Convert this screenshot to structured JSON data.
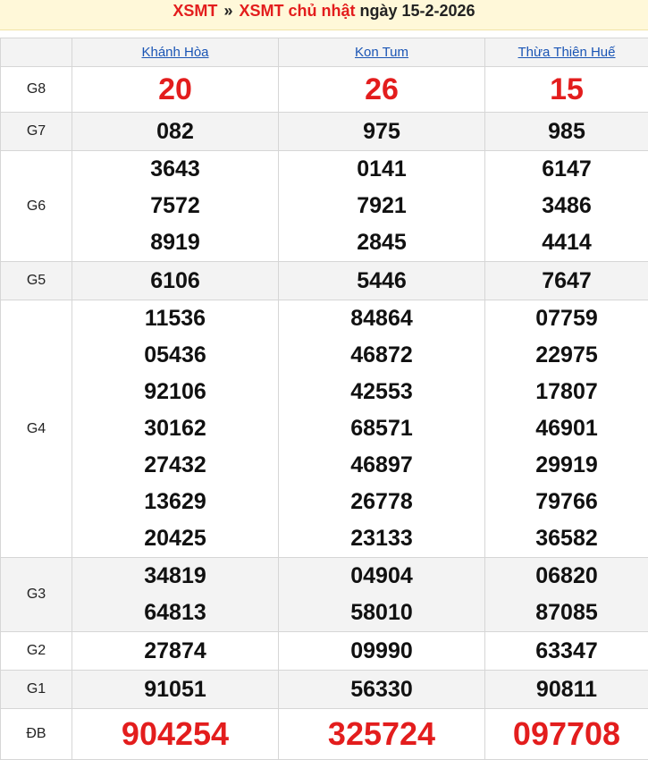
{
  "header": {
    "link1": "XSMT",
    "separator": "»",
    "link2": "XSMT chủ nhật",
    "rest": " ngày 15-2-2026"
  },
  "provinces": [
    "Khánh Hòa",
    "Kon Tum",
    "Thừa Thiên Huế"
  ],
  "prizes": [
    {
      "label": "G8",
      "cols": [
        [
          "20"
        ],
        [
          "26"
        ],
        [
          "15"
        ]
      ]
    },
    {
      "label": "G7",
      "cols": [
        [
          "082"
        ],
        [
          "975"
        ],
        [
          "985"
        ]
      ]
    },
    {
      "label": "G6",
      "cols": [
        [
          "3643",
          "7572",
          "8919"
        ],
        [
          "0141",
          "7921",
          "2845"
        ],
        [
          "6147",
          "3486",
          "4414"
        ]
      ]
    },
    {
      "label": "G5",
      "cols": [
        [
          "6106"
        ],
        [
          "5446"
        ],
        [
          "7647"
        ]
      ]
    },
    {
      "label": "G4",
      "cols": [
        [
          "11536",
          "05436",
          "92106",
          "30162",
          "27432",
          "13629",
          "20425"
        ],
        [
          "84864",
          "46872",
          "42553",
          "68571",
          "46897",
          "26778",
          "23133"
        ],
        [
          "07759",
          "22975",
          "17807",
          "46901",
          "29919",
          "79766",
          "36582"
        ]
      ]
    },
    {
      "label": "G3",
      "cols": [
        [
          "34819",
          "64813"
        ],
        [
          "04904",
          "58010"
        ],
        [
          "06820",
          "87085"
        ]
      ]
    },
    {
      "label": "G2",
      "cols": [
        [
          "27874"
        ],
        [
          "09990"
        ],
        [
          "63347"
        ]
      ]
    },
    {
      "label": "G1",
      "cols": [
        [
          "91051"
        ],
        [
          "56330"
        ],
        [
          "90811"
        ]
      ]
    },
    {
      "label": "ĐB",
      "cols": [
        [
          "904254"
        ],
        [
          "325724"
        ],
        [
          "097708"
        ]
      ]
    }
  ],
  "colors": {
    "accent_red": "#e31d1d",
    "link_blue": "#1a55b5",
    "header_bg": "#fff8d9",
    "alt_row_bg": "#f3f3f3"
  }
}
